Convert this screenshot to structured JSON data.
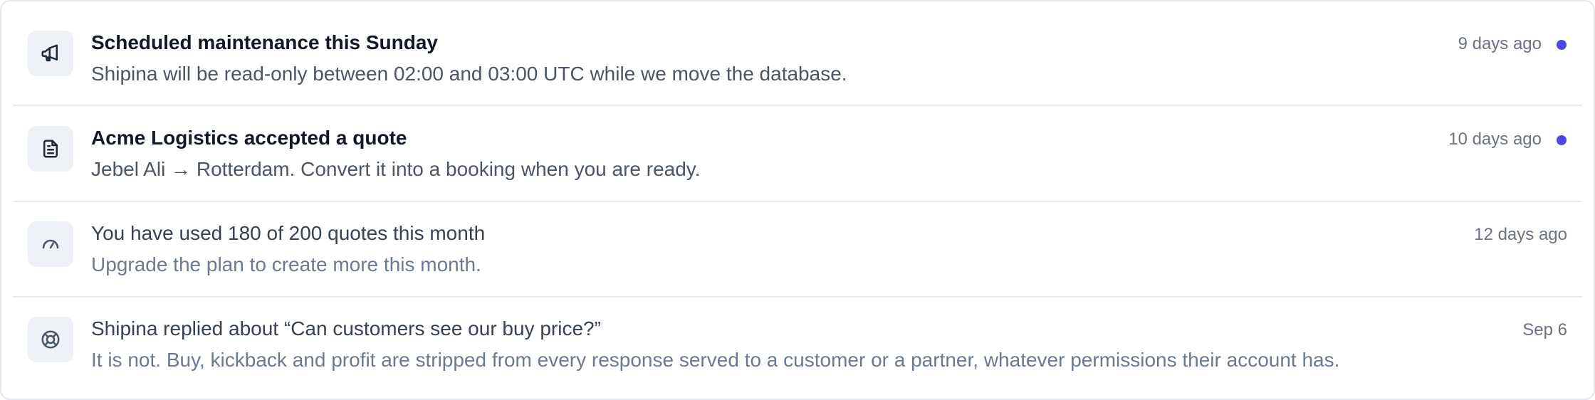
{
  "notifications": [
    {
      "icon": "megaphone-icon",
      "title": "Scheduled maintenance this Sunday",
      "description": "Shipina will be read-only between 02:00 and 03:00 UTC while we move the database.",
      "time": "9 days ago",
      "unread": true
    },
    {
      "icon": "document-icon",
      "title": "Acme Logistics accepted a quote",
      "description": "Jebel Ali → Rotterdam. Convert it into a booking when you are ready.",
      "time": "10 days ago",
      "unread": true
    },
    {
      "icon": "gauge-icon",
      "title": "You have used 180 of 200 quotes this month",
      "description": "Upgrade the plan to create more this month.",
      "time": "12 days ago",
      "unread": false
    },
    {
      "icon": "lifebuoy-icon",
      "title": "Shipina replied about “Can customers see our buy price?”",
      "description": "It is not. Buy, kickback and profit are stripped from every response served to a customer or a partner, whatever permissions their account has.",
      "time": "Sep 6",
      "unread": false
    }
  ],
  "colors": {
    "unread_dot": "#4f46e5",
    "icon_stroke": "#475569",
    "icon_background": "#eef1f5"
  }
}
